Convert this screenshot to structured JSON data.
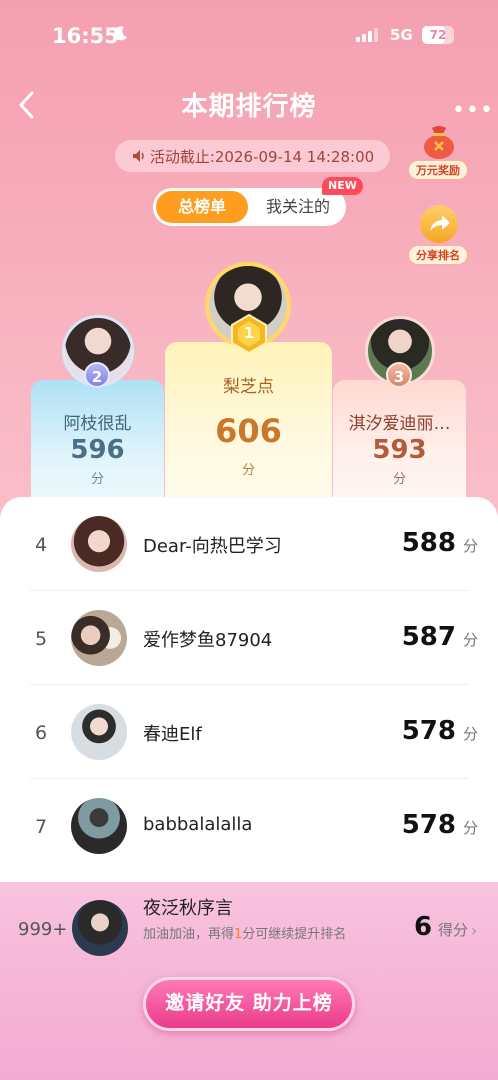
{
  "status_bar": {
    "time": "16:55",
    "network": "5G",
    "battery": "72",
    "battery_level": 0.72
  },
  "header": {
    "title": "本期排行榜",
    "more": "•••"
  },
  "deadline": {
    "text": "活动截止:2026-09-14 14:28:00"
  },
  "side_buttons": {
    "reward_label": "万元奖励",
    "share_label": "分享排名"
  },
  "tabs": {
    "active": "总榜单",
    "other": "我关注的",
    "new_badge": "NEW"
  },
  "podium": {
    "first": {
      "rank": "1",
      "name": "梨芝点",
      "score": "606",
      "unit": "分"
    },
    "second": {
      "rank": "2",
      "name": "阿枝很乱",
      "score": "596",
      "unit": "分"
    },
    "third": {
      "rank": "3",
      "name": "淇汐爱迪丽…",
      "score": "593",
      "unit": "分"
    }
  },
  "list": [
    {
      "rank": "4",
      "name": "Dear-向热巴学习",
      "score": "588",
      "unit": "分"
    },
    {
      "rank": "5",
      "name": "爱作梦鱼87904",
      "score": "587",
      "unit": "分"
    },
    {
      "rank": "6",
      "name": "春迪Elf",
      "score": "578",
      "unit": "分"
    },
    {
      "rank": "7",
      "name": "babbalalalla",
      "score": "578",
      "unit": "分"
    }
  ],
  "my_rank": {
    "rank": "999+",
    "name": "夜泛秋序言",
    "tip_before": "加油加油，再得",
    "tip_num": "1",
    "tip_after": "分可继续提升排名",
    "score": "6",
    "unit": "得分",
    "chevron": "›"
  },
  "invite": {
    "label": "邀请好友 助力上榜"
  },
  "colors": {
    "accent_orange": "#ff9d1e",
    "invite_pink": "#ea3b8a",
    "gold_score": "#c9772a",
    "blue_score": "#4a6f86"
  }
}
